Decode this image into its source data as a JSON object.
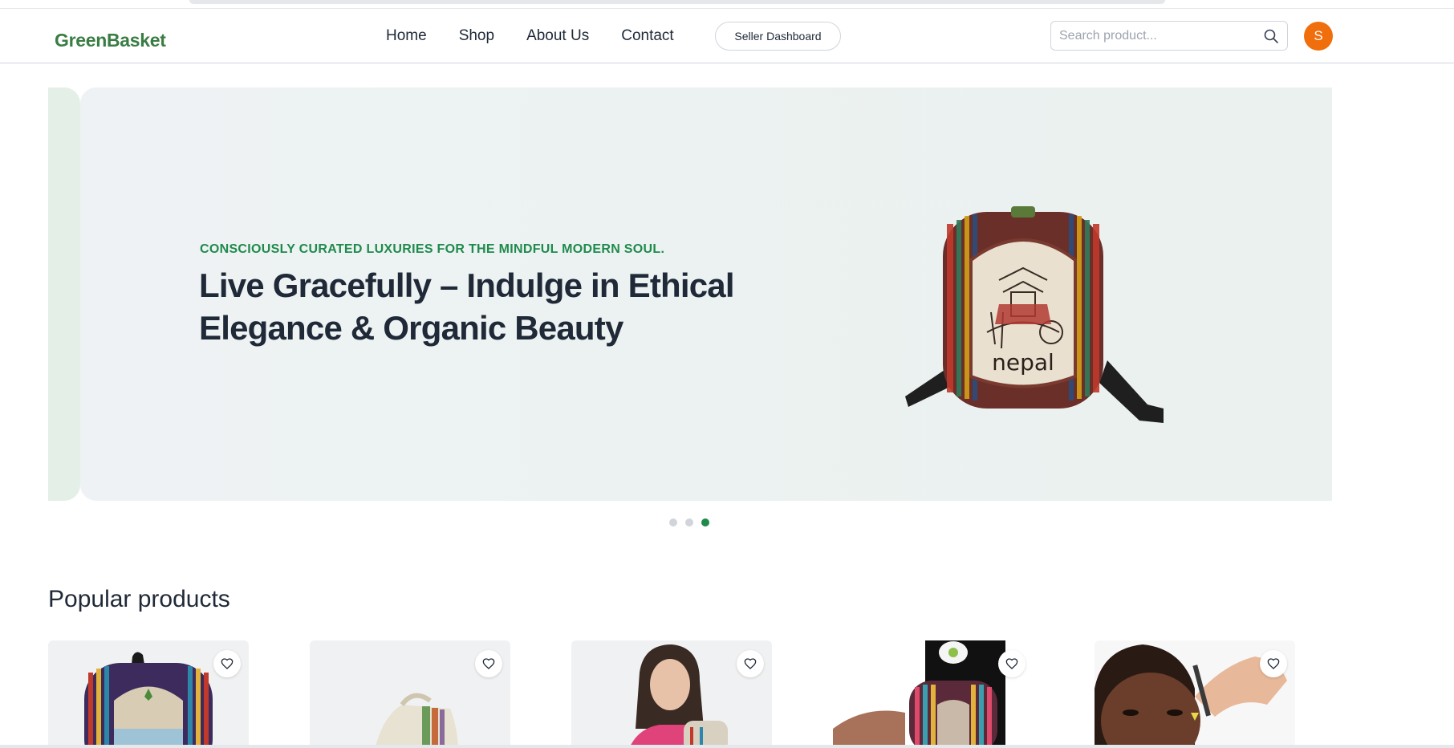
{
  "header": {
    "logo": "GreenBasket",
    "nav": [
      "Home",
      "Shop",
      "About Us",
      "Contact"
    ],
    "seller_button": "Seller Dashboard",
    "search_placeholder": "Search product...",
    "avatar_initial": "S"
  },
  "hero": {
    "eyebrow": "CONSCIOUSLY CURATED LUXURIES FOR THE MINDFUL MODERN SOUL.",
    "headline": "Live Gracefully – Indulge in Ethical Elegance & Organic Beauty",
    "bag_text": "nepal",
    "slide_count": 3,
    "active_slide": 3
  },
  "popular": {
    "title": "Popular products",
    "products": [
      {
        "icon": "hemp-backpack-image"
      },
      {
        "icon": "cream-tote-bag-image"
      },
      {
        "icon": "woman-with-backpack-image"
      },
      {
        "icon": "person-wearing-backpack-image"
      },
      {
        "icon": "face-serum-dropper-image"
      }
    ]
  },
  "colors": {
    "brand_green": "#3a7d44",
    "accent_green": "#1f8a4c",
    "avatar_orange": "#f06e0c"
  }
}
